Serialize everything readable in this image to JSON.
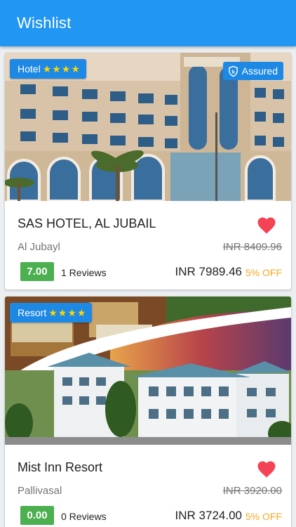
{
  "appbar": {
    "title": "Wishlist"
  },
  "hotels": [
    {
      "type": "Hotel",
      "stars": "★★★★",
      "assured": "Assured",
      "name": "SAS HOTEL, AL JUBAIL",
      "location": "Al Jubayl",
      "original_price": "INR 8409.96",
      "rating": "7.00",
      "reviews": "1 Reviews",
      "price": "INR 7989.46",
      "discount": "5% OFF"
    },
    {
      "type": "Resort",
      "stars": "★★★★",
      "name": "Mist Inn Resort",
      "location": "Pallivasal",
      "original_price": "INR 3920.00",
      "rating": "0.00",
      "reviews": "0 Reviews",
      "price": "INR 3724.00",
      "discount": "5% OFF"
    }
  ],
  "icons": {
    "favorite": "heart-icon",
    "assured": "shield-check-icon"
  },
  "colors": {
    "appbar": "#2196f3",
    "badge": "#1e88e5",
    "rating": "#4caf50",
    "heart": "#f44355",
    "discount": "#f9a825",
    "stars": "#ffd600"
  }
}
